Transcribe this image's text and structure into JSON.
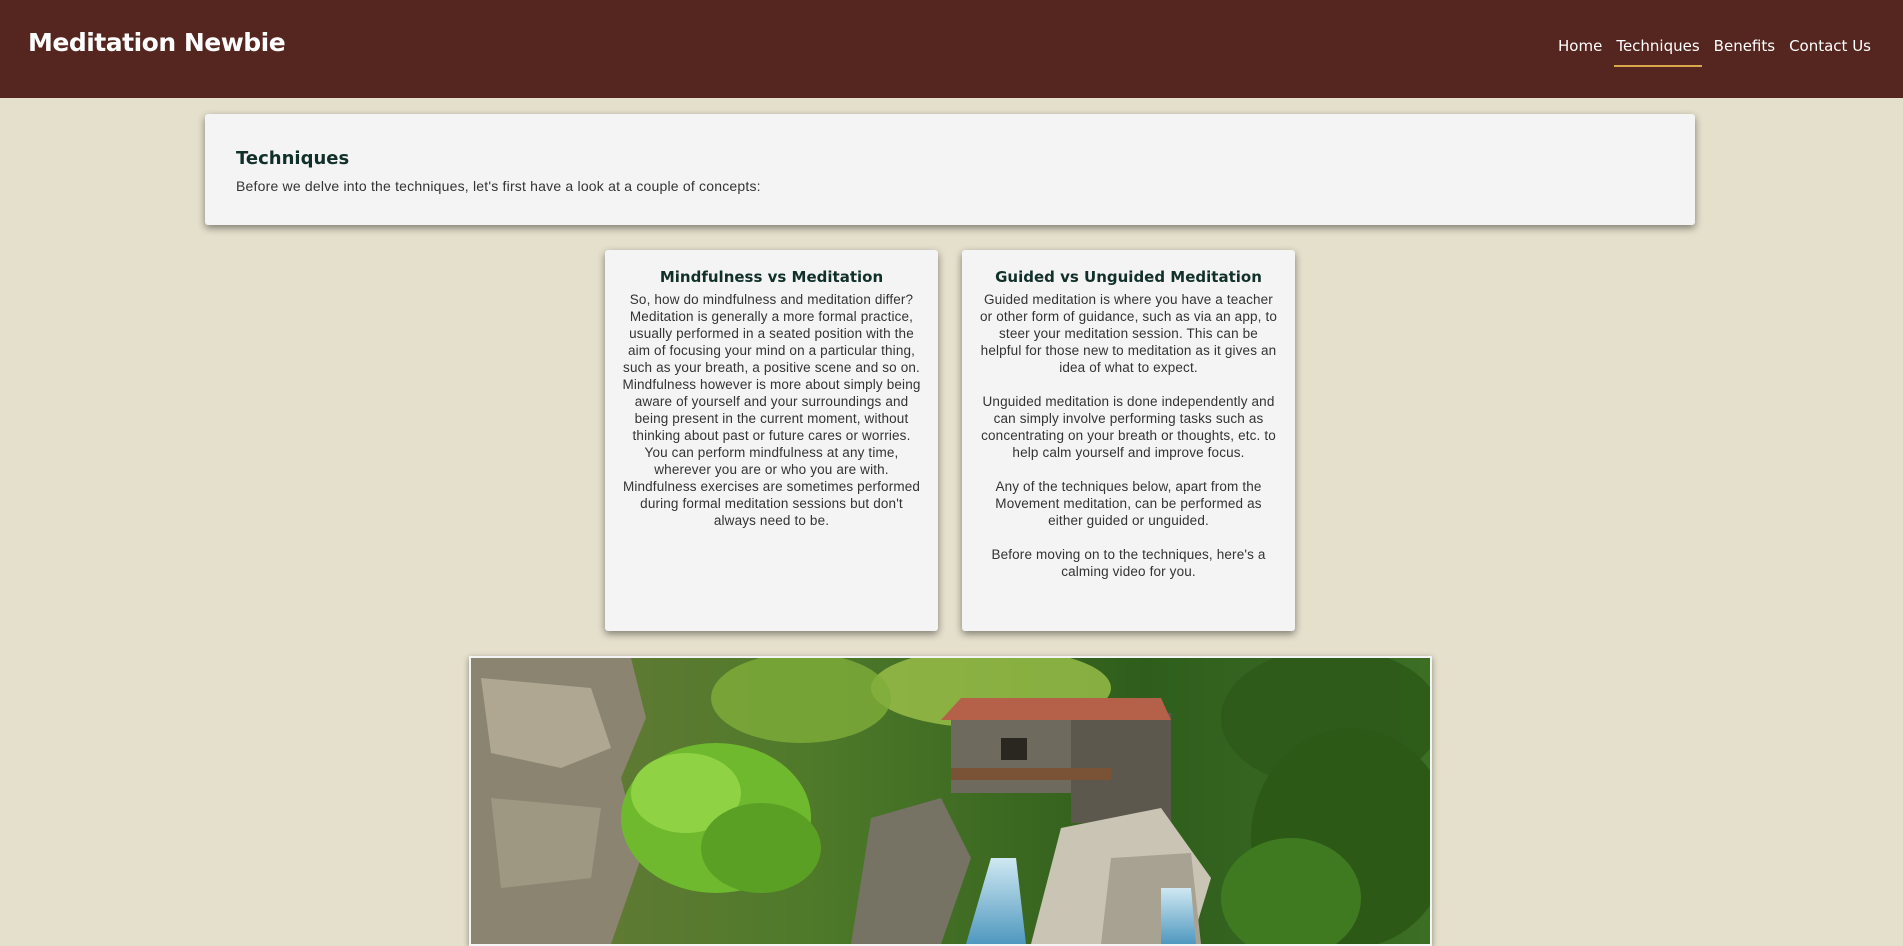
{
  "header": {
    "brand": "Meditation Newbie",
    "nav": [
      {
        "label": "Home"
      },
      {
        "label": "Techniques"
      },
      {
        "label": "Benefits"
      },
      {
        "label": "Contact Us"
      }
    ],
    "active_index": 1
  },
  "intro": {
    "title": "Techniques",
    "text": "Before we delve into the techniques, let's first have a look at a couple of concepts:"
  },
  "concepts": [
    {
      "title": "Mindfulness vs Meditation",
      "body": "So, how do mindfulness and meditation differ? Meditation is generally a more formal practice, usually performed in a seated position with the aim of focusing your mind on a particular thing, such as your breath, a positive scene and so on. Mindfulness however is more about simply being aware of yourself and your surroundings and being present in the current moment, without thinking about past or future cares or worries. You can perform mindfulness at any time, wherever you are or who you are with. Mindfulness exercises are sometimes performed during formal meditation sessions but don't always need to be."
    },
    {
      "title": "Guided vs Unguided Meditation",
      "body": "Guided meditation is where you have a teacher or other form of guidance, such as via an app, to steer your meditation session. This can be helpful for those new to meditation as it gives an idea of what to expect.\n\nUnguided meditation is done independently and can simply involve performing tasks such as concentrating on your breath or thoughts, etc. to help calm yourself and improve focus.\n\nAny of the techniques below, apart from the Movement meditation, can be performed as either guided or unguided.\n\nBefore moving on to the techniques, here's a calming video for you."
    }
  ],
  "colors": {
    "header_bg": "#55251f",
    "page_bg": "#e5e0cc",
    "card_bg": "#f4f4f4",
    "active_underline": "#d9a84a",
    "title_text": "#12302a"
  }
}
